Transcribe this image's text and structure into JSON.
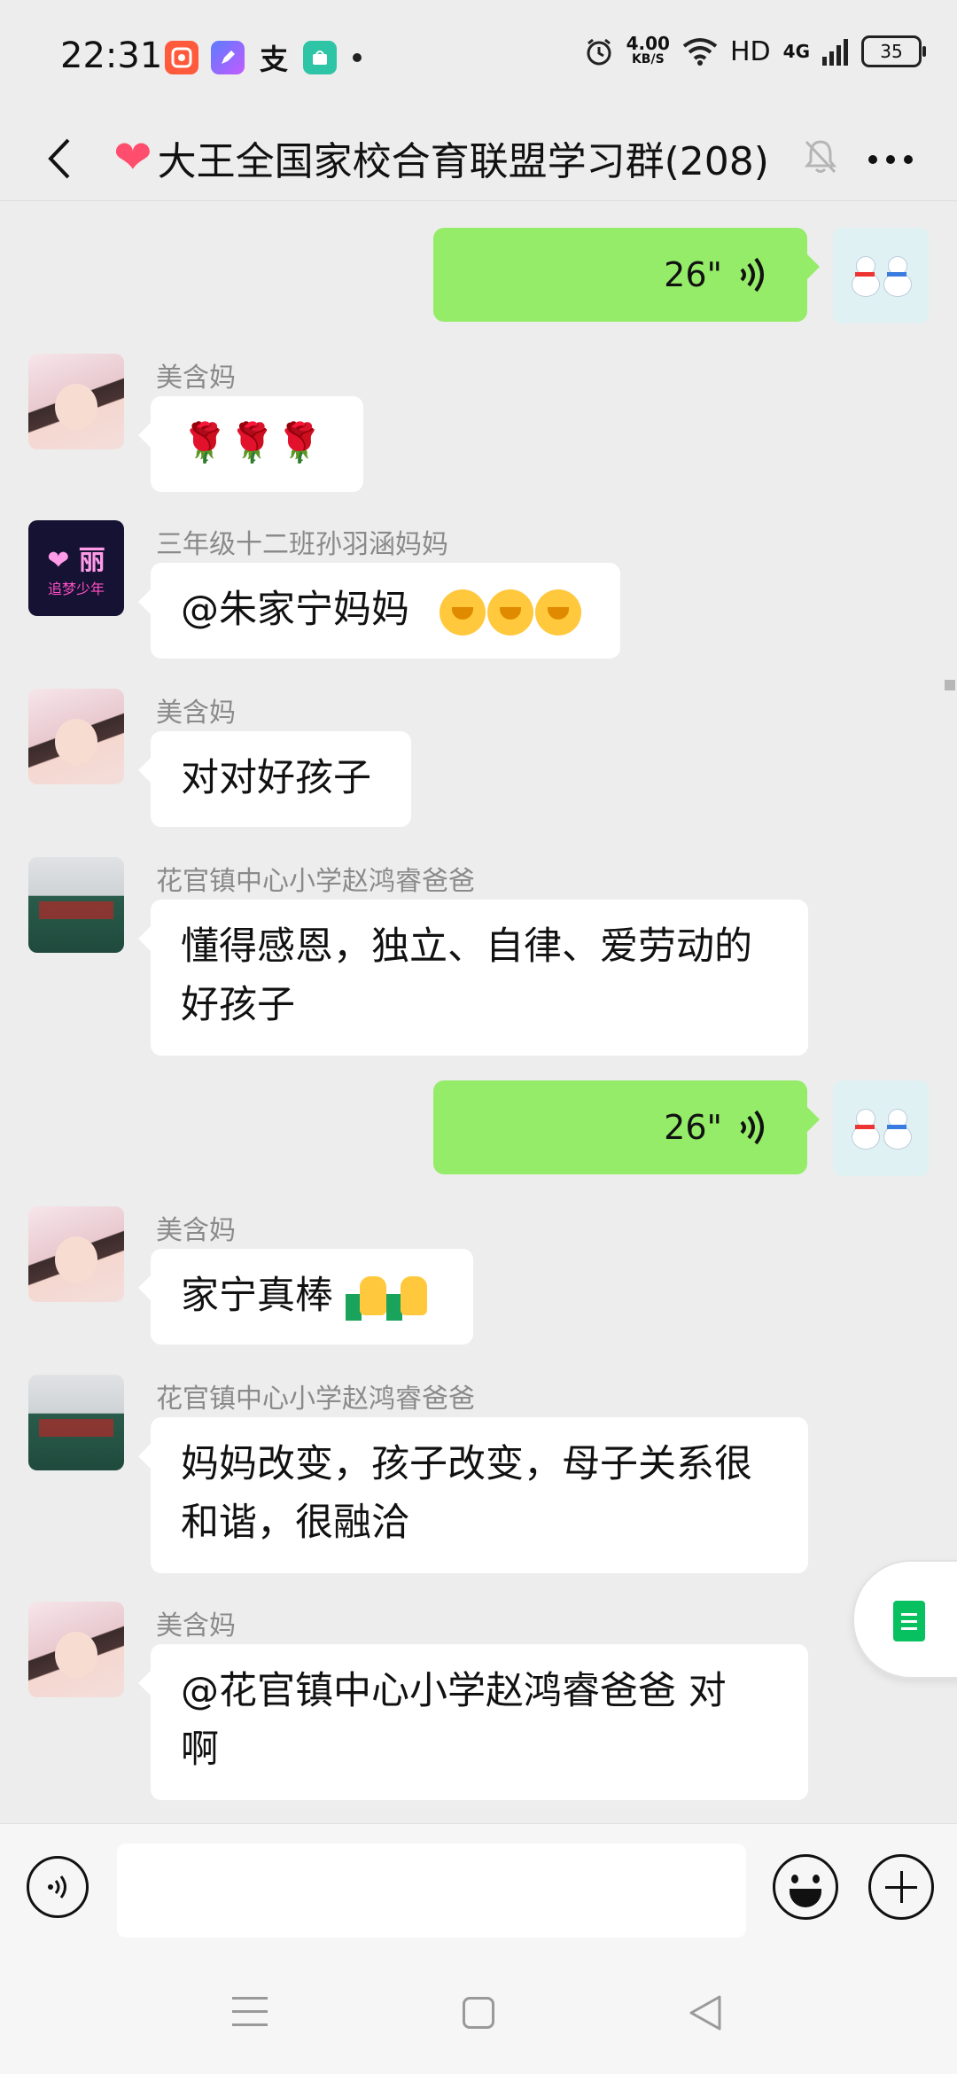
{
  "status_bar": {
    "time": "22:31",
    "net_speed_value": "4.00",
    "net_speed_unit": "KB/S",
    "hd": "HD",
    "network": "4G",
    "battery": "35",
    "app_icon_zhi": "支"
  },
  "header": {
    "title": "大王全国家校合育联盟学习群(208)",
    "heart_icon": "heart-icon",
    "mute_icon": "bell-muted-icon",
    "more_icon": "more-dots-icon"
  },
  "messages": [
    {
      "type": "voice",
      "side": "right",
      "duration": "26\""
    },
    {
      "type": "text",
      "side": "left",
      "sender": "美含妈",
      "avatar": "girl-portrait",
      "content": "🌹🌹🌹"
    },
    {
      "type": "text",
      "side": "left",
      "sender": "三年级十二班孙羽涵妈妈",
      "avatar": "neon-sign",
      "content": "@朱家宁妈妈",
      "avatar_text_1": "❤ 丽",
      "avatar_text_2": "追梦少年"
    },
    {
      "type": "text",
      "side": "left",
      "sender": "美含妈",
      "avatar": "girl-portrait",
      "content": "对对好孩子"
    },
    {
      "type": "text",
      "side": "left",
      "sender": "花官镇中心小学赵鸿睿爸爸",
      "avatar": "classroom",
      "content_line1": "懂得感恩，独立、自律、爱劳动的",
      "content_line2": "好孩子"
    },
    {
      "type": "voice",
      "side": "right",
      "duration": "26\""
    },
    {
      "type": "text",
      "side": "left",
      "sender": "美含妈",
      "avatar": "girl-portrait",
      "content": "家宁真棒"
    },
    {
      "type": "text",
      "side": "left",
      "sender": "花官镇中心小学赵鸿睿爸爸",
      "avatar": "classroom",
      "content_line1": "妈妈改变，孩子改变，母子关系很",
      "content_line2": "和谐，很融洽"
    },
    {
      "type": "text",
      "side": "left",
      "sender": "美含妈",
      "avatar": "girl-portrait",
      "content_line1": "@花官镇中心小学赵鸿睿爸爸  对",
      "content_line2": "啊"
    }
  ],
  "input_bar": {
    "placeholder": "",
    "voice_icon": "voice-input-icon",
    "emoji_icon": "emoji-icon",
    "plus_icon": "plus-icon"
  },
  "floating_button": "note-icon",
  "nav_bar": [
    "menu-icon",
    "home-icon",
    "back-icon"
  ]
}
